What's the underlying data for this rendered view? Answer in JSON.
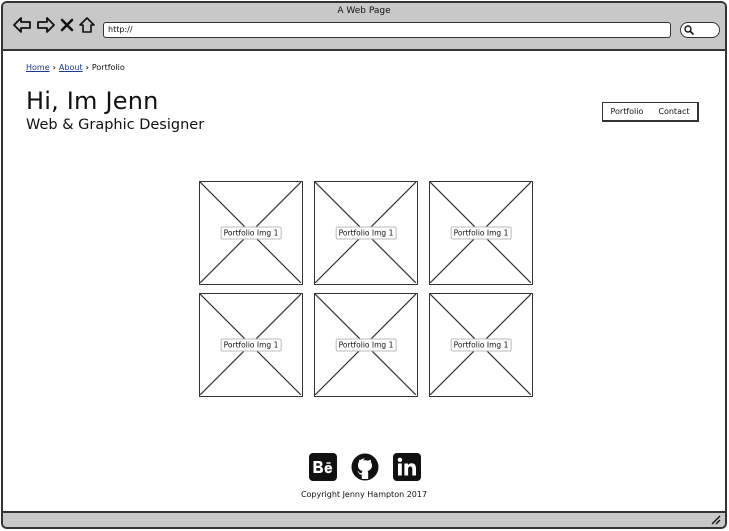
{
  "window": {
    "title": "A Web Page"
  },
  "browser": {
    "url": "http://"
  },
  "breadcrumb": {
    "home": "Home",
    "about": "About",
    "current": "Portfolio"
  },
  "hero": {
    "title": "Hi, Im Jenn",
    "subtitle": "Web & Graphic Designer"
  },
  "nav": {
    "portfolio": "Portfolio",
    "contact": "Contact"
  },
  "gallery": {
    "items": [
      {
        "caption": "Portfolio Img 1"
      },
      {
        "caption": "Portfolio Img 1"
      },
      {
        "caption": "Portfolio Img 1"
      },
      {
        "caption": "Portfolio Img 1"
      },
      {
        "caption": "Portfolio Img 1"
      },
      {
        "caption": "Portfolio Img 1"
      }
    ]
  },
  "social": {
    "icons": [
      "behance-icon",
      "github-icon",
      "linkedin-icon"
    ]
  },
  "footer": {
    "copyright": "Copyright Jenny Hampton 2017"
  },
  "colors": {
    "chrome": "#c8c8c8",
    "link": "#1a3c8c",
    "stroke": "#333333"
  }
}
